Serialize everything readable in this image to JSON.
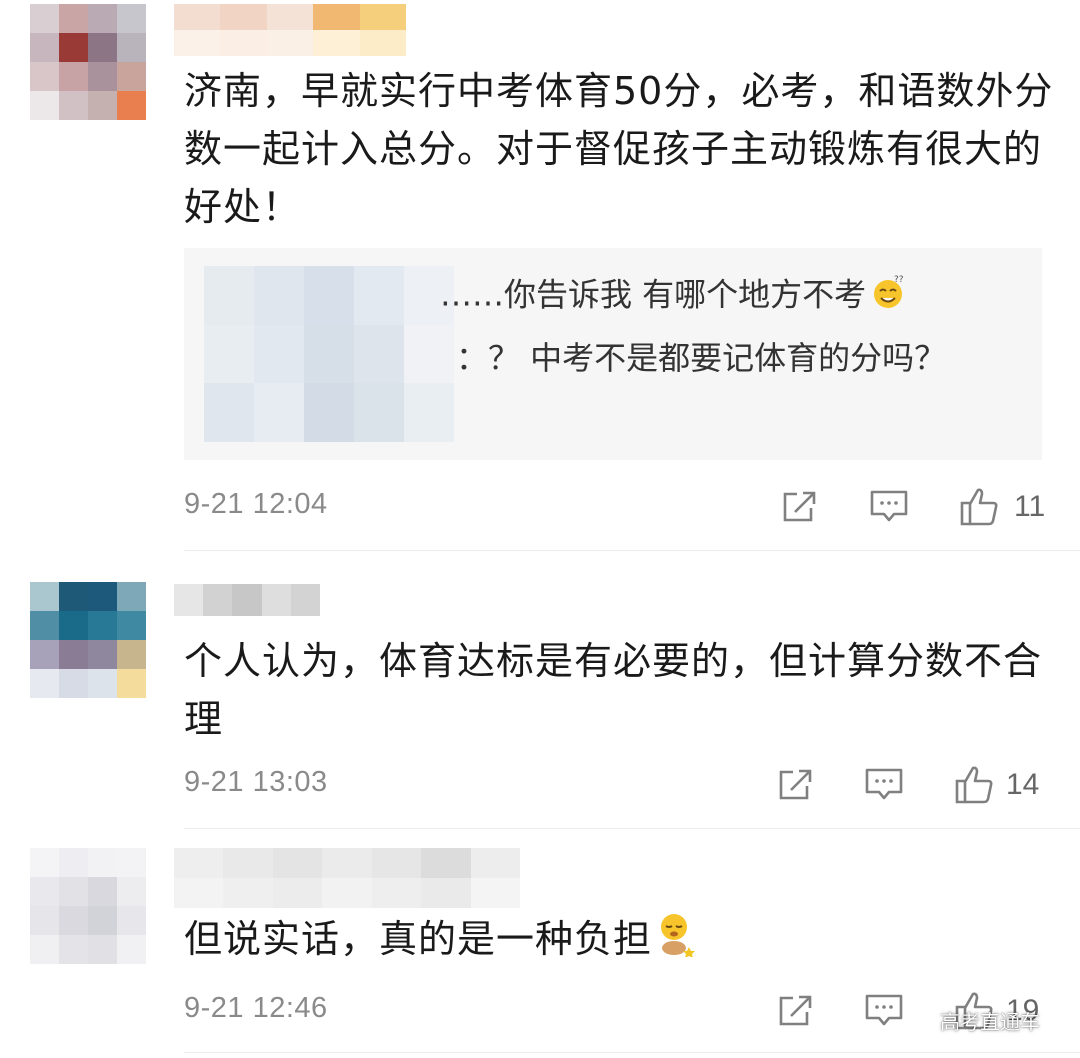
{
  "comments": [
    {
      "text": "济南，早就实行中考体育50分，必考，和语数外分数一起计入总分。对于督促孩子主动锻炼有很大的好处！",
      "replies": [
        {
          "text": "……你告诉我 有哪个地方不考"
        },
        {
          "text": "：？ 中考不是都要记体育的分吗？"
        }
      ],
      "time": "9-21 12:04",
      "likes": "11"
    },
    {
      "text": "个人认为，体育达标是有必要的，但计算分数不合理",
      "time": "9-21 13:03",
      "likes": "14"
    },
    {
      "text": "但说实话，真的是一种负担",
      "time": "9-21 12:46",
      "likes": "19"
    }
  ],
  "watermark": "高考直通车",
  "icons": {
    "share": "share-icon",
    "reply": "comment-icon",
    "like": "thumbs-up-icon"
  },
  "colors": {
    "text": "#1a1a1a",
    "meta": "#8a8a8a",
    "quote_bg": "#f6f6f6",
    "divider": "#ececec"
  }
}
